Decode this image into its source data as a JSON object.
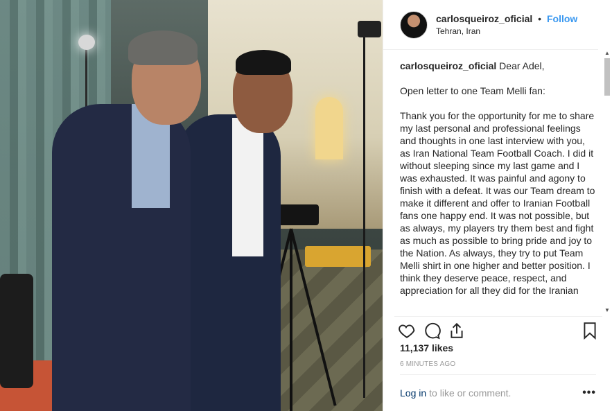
{
  "header": {
    "username": "carlosqueiroz_oficial",
    "separator": "•",
    "follow_label": "Follow",
    "location": "Tehran, Iran"
  },
  "caption": {
    "username": "carlosqueiroz_oficial",
    "greeting": "Dear Adel,",
    "line2": "Open letter to one Team Melli fan:",
    "body": "Thank you for the opportunity for me to share my last personal and professional feelings and thoughts in one last interview with you, as Iran National Team Football Coach. I did it without sleeping since my last game and I was exhausted. It was painful and agony to finish with a defeat. It was our Team dream to make it different and offer to Iranian Football fans one happy end. It was not possible, but as always, my players try them best and fight as much as possible to bring pride and joy to the Nation. As always, they try to put Team Melli shirt in one higher and better position. I think they deserve peace, respect, and appreciation for all they did for the Iranian"
  },
  "icons": {
    "like": "heart-icon",
    "comment": "comment-icon",
    "share": "share-icon",
    "save": "bookmark-icon",
    "more": "more-icon"
  },
  "stats": {
    "likes": "11,137 likes",
    "time": "6 MINUTES AGO"
  },
  "footer": {
    "login_label": "Log in",
    "login_rest": "to like or comment.",
    "more_label": "•••"
  },
  "colors": {
    "link": "#3897f0",
    "login": "#003569",
    "muted": "#999999",
    "divider": "#efefef"
  }
}
